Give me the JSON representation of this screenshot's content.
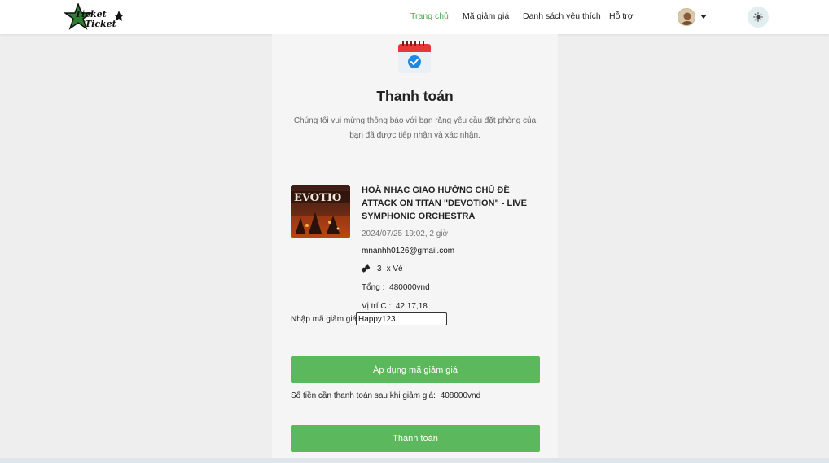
{
  "header": {
    "logo_text": "Ticket Ticket",
    "nav": {
      "home": "Trang chủ",
      "vouchers": "Mã giảm giá",
      "wishlist": "Danh sách yêu thích",
      "support": "Hỗ trợ"
    },
    "active_nav": "home",
    "accent_color": "#4caf50"
  },
  "payment": {
    "title": "Thanh toán",
    "intro": "Chúng tôi vui mừng thông báo với bạn rằng yêu cầu đặt phòng của bạn đã được tiếp nhận và xác nhận.",
    "event_title": "HOÀ NHẠC GIAO HƯỞNG CHỦ ĐỀ ATTACK ON TITAN \"DEVOTION\" - LIVE SYMPHONIC ORCHESTRA",
    "event_time": "2024/07/25 19:02, 2 giờ",
    "email": "mnanhh0126@gmail.com",
    "ticket_qty": "3",
    "ticket_unit": "x Vé",
    "total_label": "Tổng :",
    "total_value": "480000vnd",
    "seat_label": "Vị trí C :",
    "seat_value": "42,17,18",
    "coupon_label": "Nhập mã giảm giá:",
    "coupon_value": "Happy123",
    "apply_button": "Áp dụng mã giảm giá",
    "after_discount_label": "Số tiền cần thanh toán sau khi giảm giá:",
    "after_discount_value": "408000vnd",
    "pay_button": "Thanh toán",
    "button_color": "#5cb85c"
  },
  "icons": {
    "calendar": "calendar-check-icon",
    "ticket": "ticket-icon",
    "theme": "sun-icon",
    "dropdown": "chevron-down-icon"
  }
}
